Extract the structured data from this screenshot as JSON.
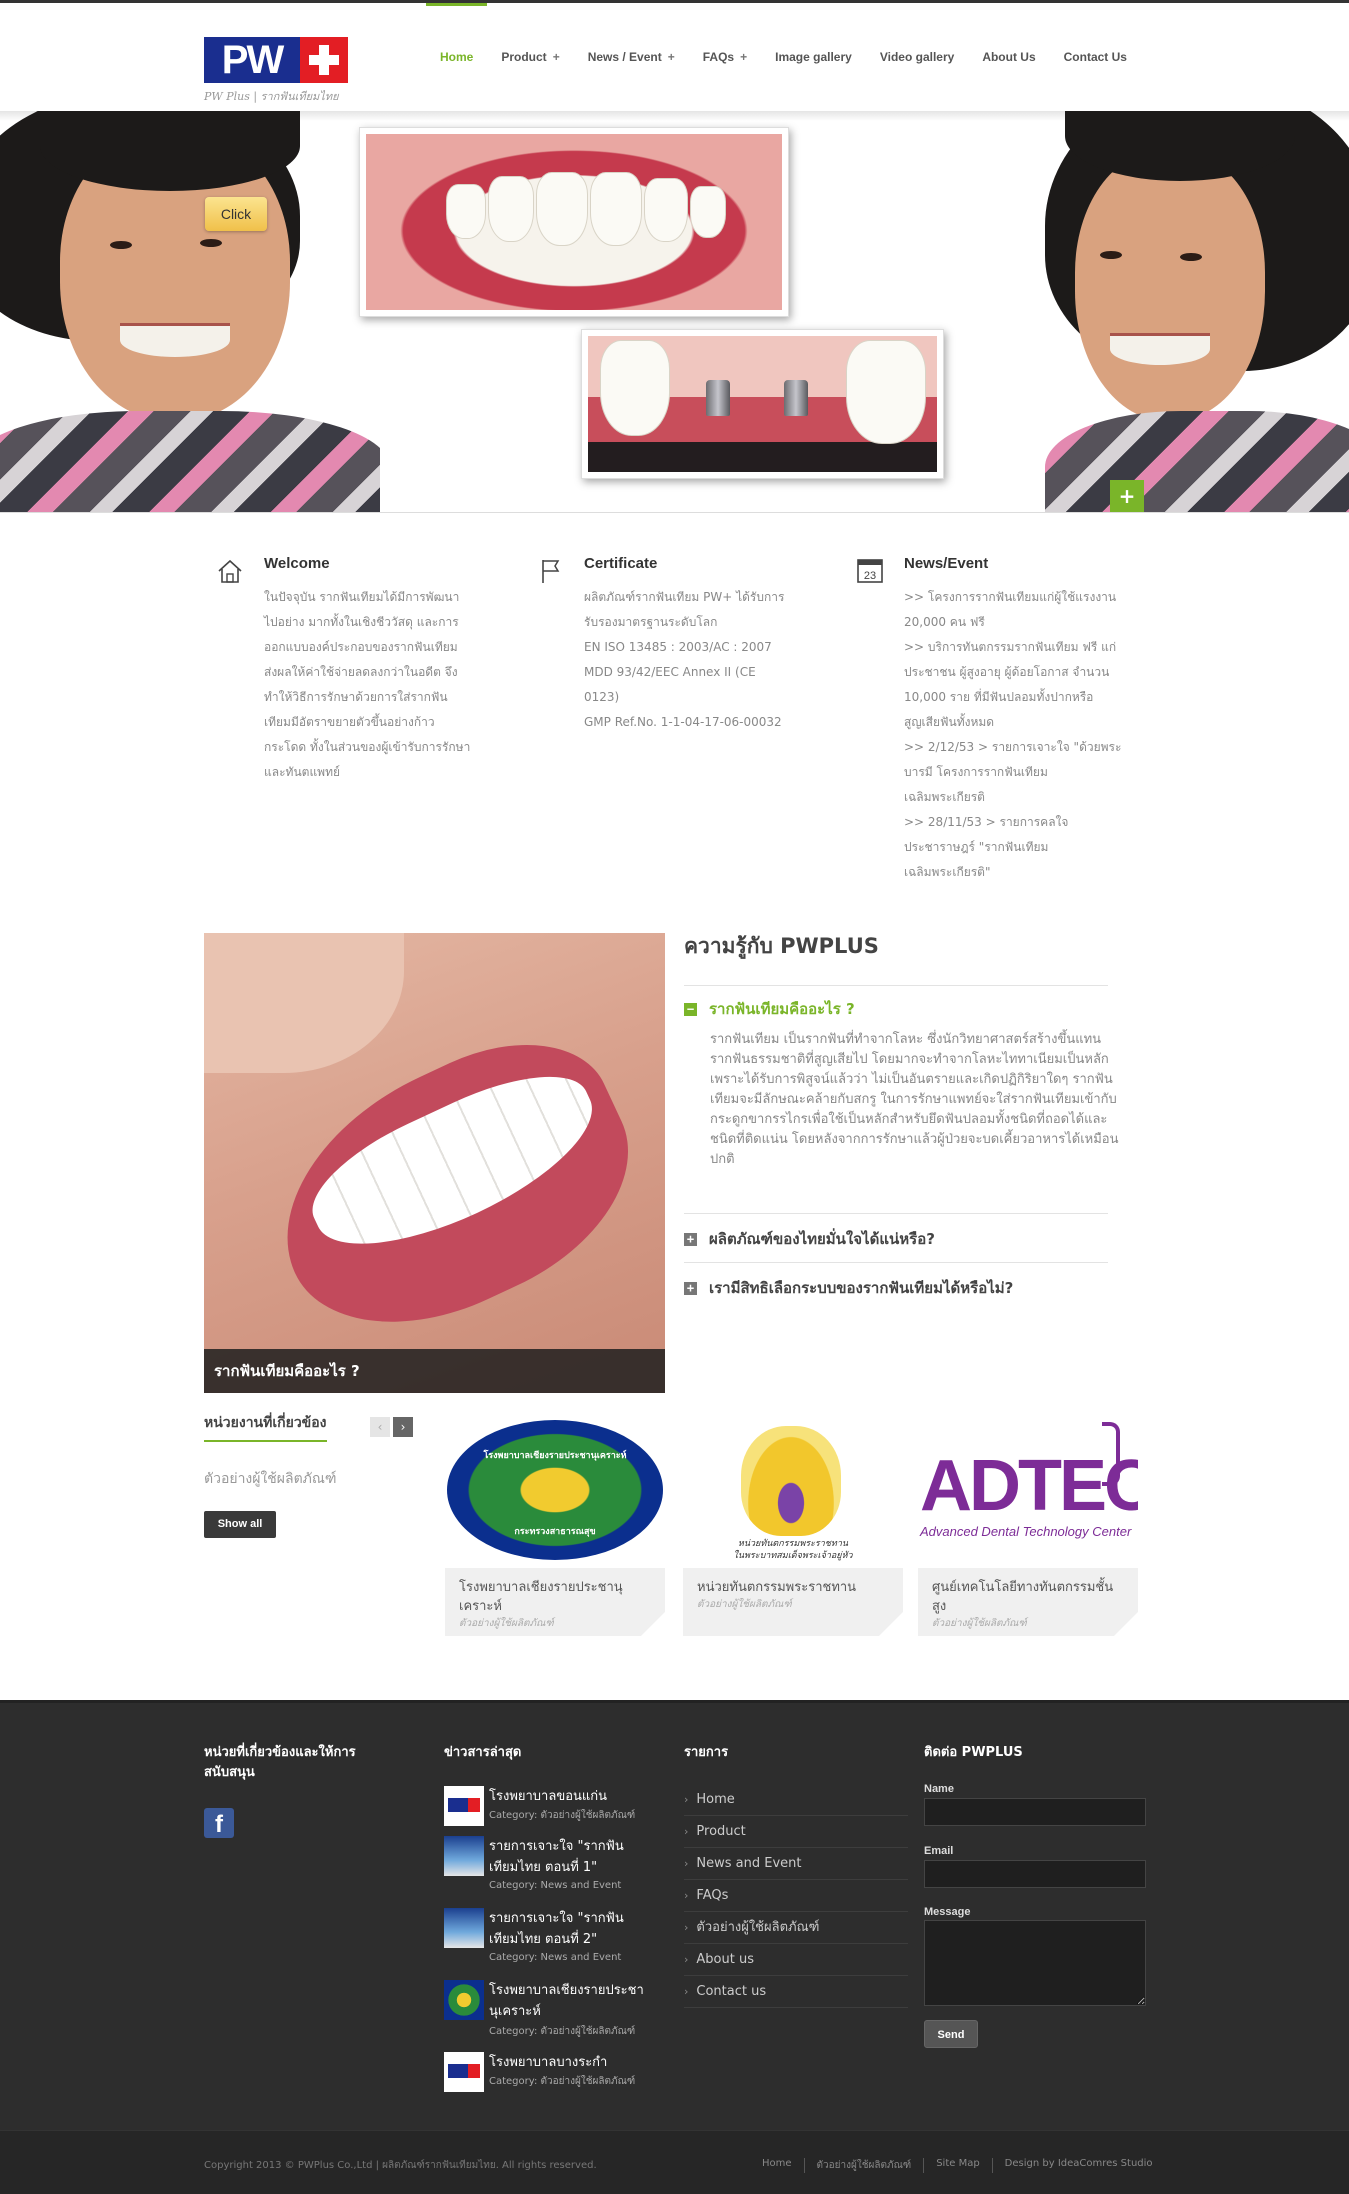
{
  "header": {
    "logo_tagline": "PW Plus | รากฟันเทียมไทย",
    "nav": [
      {
        "label": "Home",
        "plus": ""
      },
      {
        "label": "Product",
        "plus": "+"
      },
      {
        "label": "News / Event",
        "plus": "+"
      },
      {
        "label": "FAQs",
        "plus": "+"
      },
      {
        "label": "Image gallery",
        "plus": ""
      },
      {
        "label": "Video gallery",
        "plus": ""
      },
      {
        "label": "About Us",
        "plus": ""
      },
      {
        "label": "Contact Us",
        "plus": ""
      }
    ]
  },
  "slider": {
    "click_label": "Click",
    "plus_label": "+"
  },
  "features": [
    {
      "title": "Welcome",
      "icon": "home-icon",
      "text": "ในปัจจุบัน รากฟันเทียมได้มีการพัฒนา\nไปอย่าง มากทั้งในเชิงชีววัสดุ และการ\nออกแบบองค์ประกอบของรากฟันเทียม\nส่งผลให้ค่าใช้จ่ายลดลงกว่าในอดีต จึง\nทำให้วิธีการรักษาด้วยการใส่รากฟัน\nเทียมมีอัตราขยายตัวขึ้นอย่างก้าว\nกระโดด ทั้งในส่วนของผู้เข้ารับการรักษา\nและทันตแพทย์"
    },
    {
      "title": "Certificate",
      "icon": "flag-icon",
      "text": "ผลิตภัณฑ์รากฟันเทียม PW+ ได้รับการ\nรับรองมาตรฐานระดับโลก\nEN ISO 13485 : 2003/AC : 2007\nMDD 93/42/EEC Annex II (CE\n0123)\nGMP Ref.No. 1-1-04-17-06-00032"
    },
    {
      "title": "News/Event",
      "icon": "calendar-icon",
      "calendar_day": "23",
      "text": ">> โครงการรากฟันเทียมแก่ผู้ใช้แรงงาน\n20,000 คน ฟรี\n>> บริการทันตกรรมรากฟันเทียม ฟรี แก่\nประชาชน ผู้สูงอายุ ผู้ด้อยโอกาส จำนวน\n10,000 ราย ที่มีฟันปลอมทั้งปากหรือ\nสูญเสียฟันทั้งหมด\n>> 2/12/53 > รายการเจาะใจ \"ด้วยพระ\nบารมี โครงการรากฟันเทียม\nเฉลิมพระเกียรติ\n>> 28/11/53 > รายการคลใจ\nประชาราษฎร์ \"รากฟันเทียม\nเฉลิมพระเกียรติ\""
    }
  ],
  "knowledge": {
    "image_caption": "รากฟันเทียมคืออะไร ?",
    "title": "ความรู้กับ PWPLUS",
    "accordion": [
      {
        "question": "รากฟันเทียมคืออะไร ?",
        "symbol": "−",
        "answer": "รากฟันเทียม เป็นรากฟันที่ทำจากโลหะ ซึ่งนักวิทยาศาสตร์สร้างขึ้นแทนรากฟันธรรมชาติที่สูญเสียไป โดยมากจะทำจากโลหะไททาเนียมเป็นหลัก เพราะได้รับการพิสูจน์แล้วว่า ไม่เป็นอันตรายและเกิดปฏิกิริยาใดๆ รากฟันเทียมจะมีลักษณะคล้ายกับสกรู ในการรักษาแพทย์จะใส่รากฟันเทียมเข้ากับกระดูกขากรรไกรเพื่อใช้เป็นหลักสำหรับยึดฟันปลอมทั้งชนิดที่ถอดได้และชนิดที่ติดแน่น โดยหลังจากการรักษาแล้วผู้ป่วยจะบดเคี้ยวอาหารได้เหมือนปกติ"
      },
      {
        "question": "ผลิตภัณฑ์ของไทยมั่นใจได้แน่หรือ?",
        "symbol": "+"
      },
      {
        "question": "เรามีสิทธิเลือกระบบของรากฟันเทียมได้หรือไม่?",
        "symbol": "+"
      }
    ]
  },
  "related": {
    "title": "หน่วยงานที่เกี่ยวข้อง",
    "prev": "‹",
    "next": "›",
    "subtitle": "ตัวอย่างผู้ใช้ผลิตภัณฑ์",
    "show_all": "Show all",
    "cards": [
      {
        "title": "โรงพยาบาลเชียงรายประชานุเคราะห์",
        "category": "ตัวอย่างผู้ใช้ผลิตภัณฑ์",
        "seal_top": "โรงพยาบาลเชียงรายประชานุเคราะห์",
        "seal_bottom": "กระทรวงสาธารณสุข"
      },
      {
        "title": "หน่วยทันตกรรมพระราชทาน",
        "category": "ตัวอย่างผู้ใช้ผลิตภัณฑ์",
        "emblem_caption": "หน่วยทันตกรรมพระราชทาน\nในพระบาทสมเด็จพระเจ้าอยู่หัว"
      },
      {
        "title": "ศูนย์เทคโนโลยีทางทันตกรรมชั้นสูง",
        "category": "ตัวอย่างผู้ใช้ผลิตภัณฑ์",
        "logo_text": "ADTEC",
        "logo_sub": "Advanced Dental Technology Center"
      }
    ]
  },
  "footer": {
    "col1_title": "หน่วยที่เกี่ยวข้องและให้การสนับสนุน",
    "facebook_glyph": "f",
    "col2_title": "ข่าวสารล่าสุด",
    "news": [
      {
        "title": "โรงพยาบาลขอนแก่น",
        "category": "Category: ตัวอย่างผู้ใช้ผลิตภัณฑ์"
      },
      {
        "title": "รายการเจาะใจ \"รากฟันเทียมไทย ตอนที่ 1\"",
        "category": "Category: News and Event"
      },
      {
        "title": "รายการเจาะใจ \"รากฟันเทียมไทย ตอนที่ 2\"",
        "category": "Category: News and Event"
      },
      {
        "title": "โรงพยาบาลเชียงรายประชานุเคราะห์",
        "category": "Category: ตัวอย่างผู้ใช้ผลิตภัณฑ์"
      },
      {
        "title": "โรงพยาบาลบางระกำ",
        "category": "Category: ตัวอย่างผู้ใช้ผลิตภัณฑ์"
      }
    ],
    "col3_title": "รายการ",
    "menu": [
      "Home",
      "Product",
      "News and Event",
      "FAQs",
      "ตัวอย่างผู้ใช้ผลิตภัณฑ์",
      "About us",
      "Contact us"
    ],
    "col4_title": "ติดต่อ PWPLUS",
    "form": {
      "name_label": "Name",
      "email_label": "Email",
      "message_label": "Message",
      "send_label": "Send"
    }
  },
  "bottom": {
    "copyright": "Copyright 2013 © PWPlus Co.,Ltd | ผลิตภัณฑ์รากฟันเทียมไทย. All rights reserved.",
    "links": [
      "Home",
      "ตัวอย่างผู้ใช้ผลิตภัณฑ์",
      "Site Map",
      "Design by IdeaComres Studio"
    ]
  },
  "colors": {
    "accent": "#7ab529",
    "logo_blue": "#1a2e8f",
    "logo_red": "#e31e24",
    "footer_bg": "#2d2d2d"
  }
}
